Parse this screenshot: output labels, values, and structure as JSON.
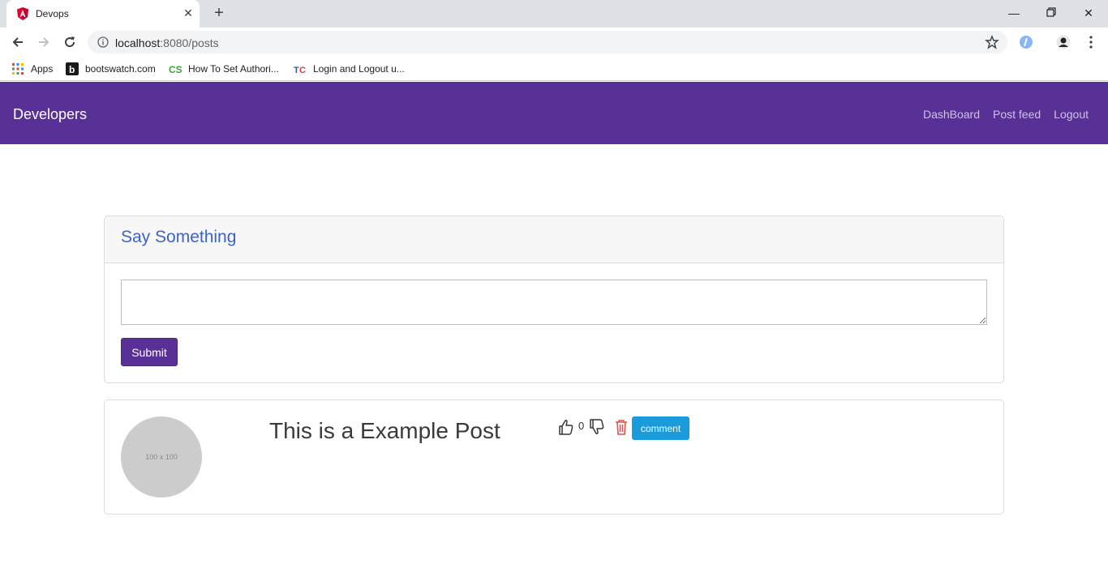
{
  "browser": {
    "tab_title": "Devops",
    "address_host": "localhost",
    "address_path": ":8080/posts",
    "bookmarks": [
      {
        "label": "Apps",
        "icon": "apps-grid-icon"
      },
      {
        "label": "bootswatch.com",
        "icon": "bootswatch-icon"
      },
      {
        "label": "How To Set Authori...",
        "icon": "cs-icon"
      },
      {
        "label": "Login and Logout u...",
        "icon": "tc-icon"
      }
    ]
  },
  "navbar": {
    "brand": "Developers",
    "links": [
      "DashBoard",
      "Post feed",
      "Logout"
    ],
    "bg_color": "#593196"
  },
  "post_form": {
    "title": "Say Something",
    "textarea_value": "",
    "submit_label": "Submit"
  },
  "post": {
    "avatar_placeholder": "100 x 100",
    "title": "This is a Example Post",
    "like_count": "0",
    "comment_label": "comment"
  },
  "colors": {
    "primary": "#593196",
    "info": "#1a9bdb",
    "danger": "#d9534f",
    "heading": "#3d63c6"
  }
}
